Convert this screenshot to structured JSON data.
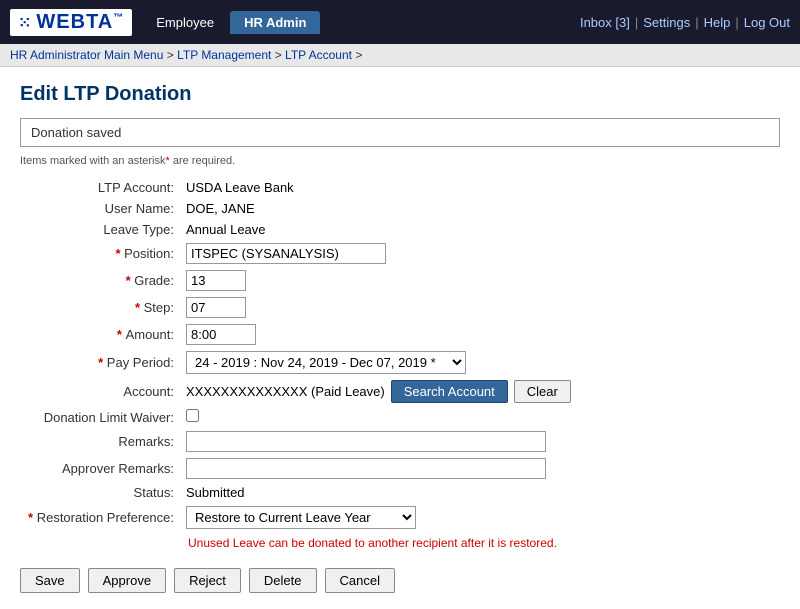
{
  "header": {
    "logo_text": "WEBTA",
    "inbox_label": "Inbox [3]",
    "settings_label": "Settings",
    "help_label": "Help",
    "logout_label": "Log Out",
    "nav_tabs": [
      {
        "id": "employee",
        "label": "Employee",
        "active": false
      },
      {
        "id": "hradmin",
        "label": "HR Admin",
        "active": true
      }
    ]
  },
  "breadcrumb": {
    "items": [
      {
        "label": "HR Administrator Main Menu",
        "href": "#"
      },
      {
        "label": "LTP Management",
        "href": "#"
      },
      {
        "label": "LTP Account",
        "href": "#"
      }
    ]
  },
  "page": {
    "title": "Edit LTP Donation",
    "saved_message": "Donation saved",
    "required_note": "Items marked with an asterisk* are required."
  },
  "form": {
    "ltp_account_label": "LTP Account:",
    "ltp_account_value": "USDA Leave Bank",
    "user_name_label": "User Name:",
    "user_name_value": "DOE, JANE",
    "leave_type_label": "Leave Type:",
    "leave_type_value": "Annual Leave",
    "position_label": "Position:",
    "position_value": "ITSPEC (SYSANALYSIS)",
    "grade_label": "Grade:",
    "grade_value": "13",
    "step_label": "Step:",
    "step_value": "07",
    "amount_label": "Amount:",
    "amount_value": "8:00",
    "pay_period_label": "Pay Period:",
    "pay_period_value": "24 - 2019 : Nov 24, 2019 - Dec 07, 2019 *",
    "pay_period_options": [
      "24 - 2019 : Nov 24, 2019 - Dec 07, 2019 *"
    ],
    "account_label": "Account:",
    "account_value": "XXXXXXXXXXXXXX (Paid Leave)",
    "search_account_label": "Search Account",
    "clear_label": "Clear",
    "donation_limit_label": "Donation Limit Waiver:",
    "remarks_label": "Remarks:",
    "remarks_value": "",
    "approver_remarks_label": "Approver Remarks:",
    "approver_remarks_value": "",
    "status_label": "Status:",
    "status_value": "Submitted",
    "restoration_label": "Restoration Preference:",
    "restoration_value": "Restore to Current Leave Year",
    "restoration_options": [
      "Restore to Current Leave Year"
    ],
    "unused_leave_note": "Unused Leave can be donated to another recipient after it is restored."
  },
  "buttons": {
    "save_label": "Save",
    "approve_label": "Approve",
    "reject_label": "Reject",
    "delete_label": "Delete",
    "cancel_label": "Cancel"
  }
}
